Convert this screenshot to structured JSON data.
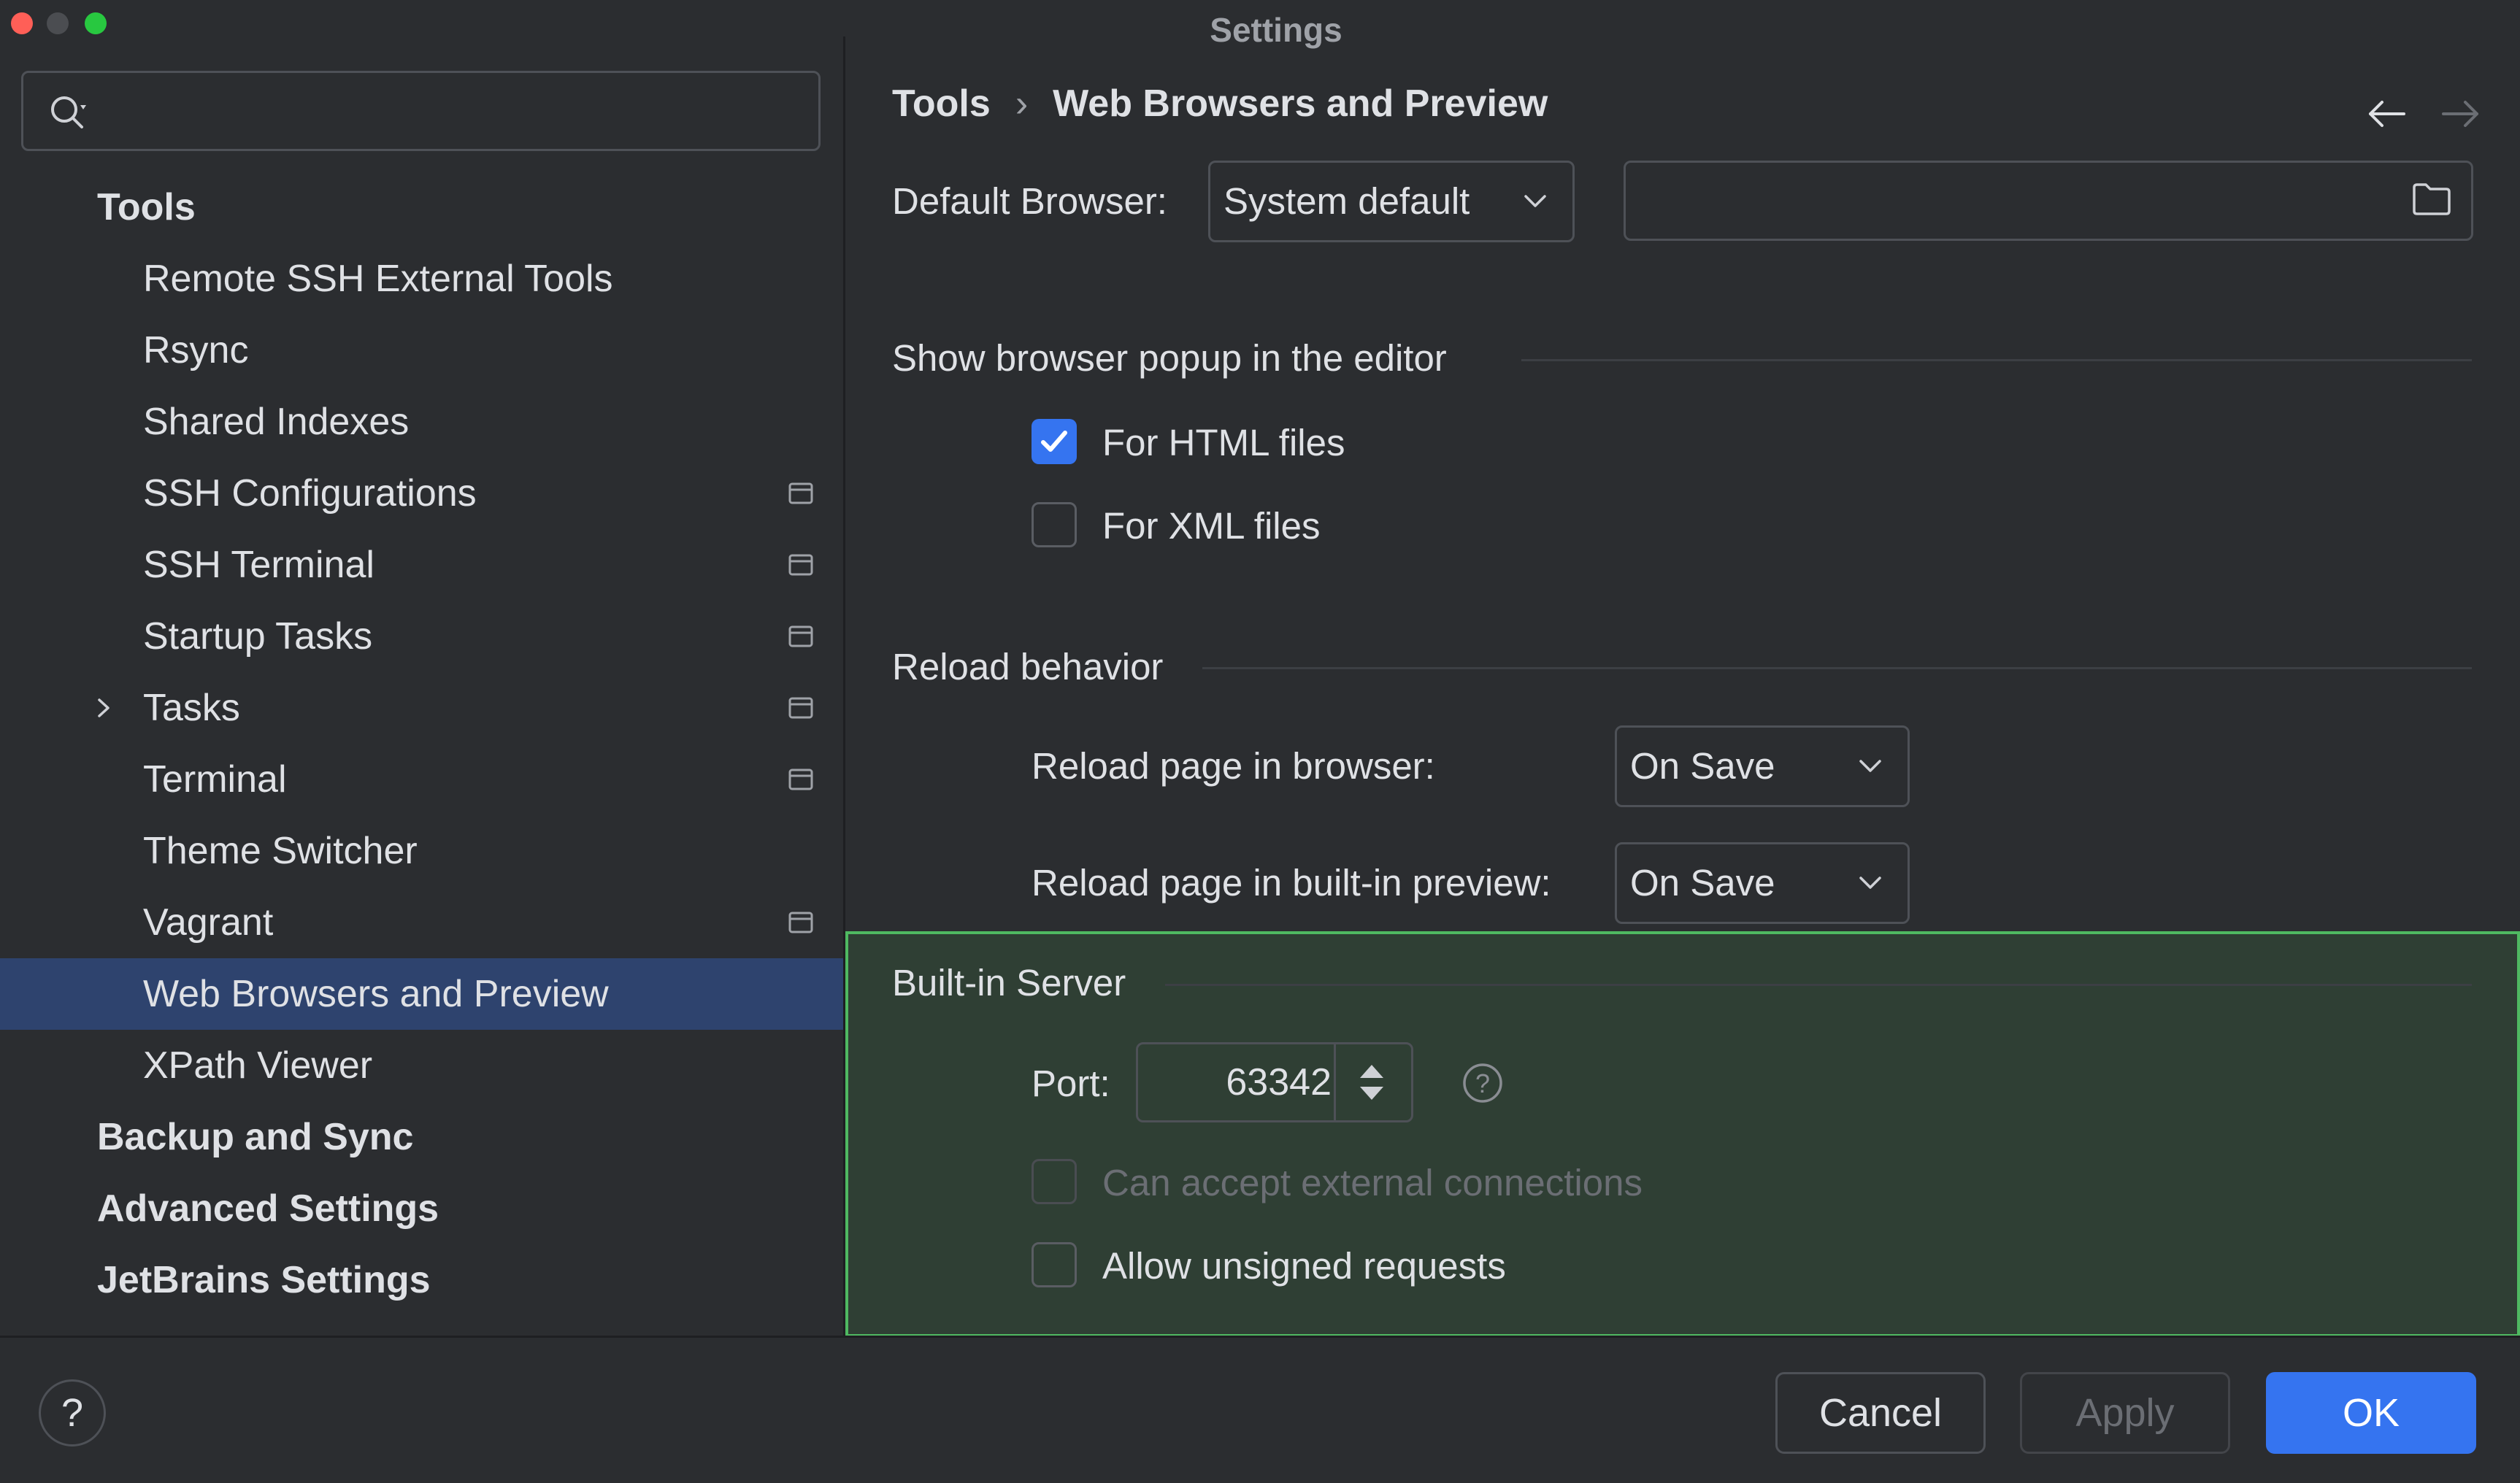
{
  "window": {
    "title": "Settings"
  },
  "search": {
    "value": "",
    "placeholder": ""
  },
  "sidebar": {
    "items": [
      {
        "label": "Tools",
        "level": 0
      },
      {
        "label": "Remote SSH External Tools",
        "level": 1
      },
      {
        "label": "Rsync",
        "level": 1
      },
      {
        "label": "Shared Indexes",
        "level": 1
      },
      {
        "label": "SSH Configurations",
        "level": 1,
        "project_icon": true
      },
      {
        "label": "SSH Terminal",
        "level": 1,
        "project_icon": true
      },
      {
        "label": "Startup Tasks",
        "level": 1,
        "project_icon": true
      },
      {
        "label": "Tasks",
        "level": 1,
        "project_icon": true,
        "expandable": true
      },
      {
        "label": "Terminal",
        "level": 1,
        "project_icon": true
      },
      {
        "label": "Theme Switcher",
        "level": 1
      },
      {
        "label": "Vagrant",
        "level": 1,
        "project_icon": true
      },
      {
        "label": "Web Browsers and Preview",
        "level": 1,
        "selected": true
      },
      {
        "label": "XPath Viewer",
        "level": 1
      },
      {
        "label": "Backup and Sync",
        "level": 0
      },
      {
        "label": "Advanced Settings",
        "level": 0
      },
      {
        "label": "JetBrains Settings",
        "level": 0
      }
    ]
  },
  "breadcrumb": {
    "parent": "Tools",
    "separator": "›",
    "current": "Web Browsers and Preview"
  },
  "default_browser": {
    "label": "Default Browser:",
    "value": "System default",
    "path_value": ""
  },
  "popup_section": {
    "title": "Show browser popup in the editor",
    "html_label": "For HTML files",
    "html_checked": true,
    "xml_label": "For XML files",
    "xml_checked": false
  },
  "reload_section": {
    "title": "Reload behavior",
    "browser_label": "Reload page in browser:",
    "browser_value": "On Save",
    "preview_label": "Reload page in built-in preview:",
    "preview_value": "On Save"
  },
  "server_section": {
    "title": "Built-in Server",
    "port_label": "Port:",
    "port_value": "63342",
    "external_label": "Can accept external connections",
    "external_checked": false,
    "external_enabled": false,
    "unsigned_label": "Allow unsigned requests",
    "unsigned_checked": false
  },
  "footer": {
    "help": "?",
    "cancel": "Cancel",
    "apply": "Apply",
    "ok": "OK"
  },
  "colors": {
    "background": "#2b2d30",
    "selection": "#2e436e",
    "accent": "#3574f0",
    "highlight_border": "#4fb961",
    "highlight_fill": "#2f3f34"
  },
  "icons": {
    "search": "search-icon",
    "project": "project-scope-icon",
    "folder": "folder-icon",
    "back": "arrow-left-icon",
    "forward": "arrow-right-icon",
    "help": "help-icon"
  }
}
